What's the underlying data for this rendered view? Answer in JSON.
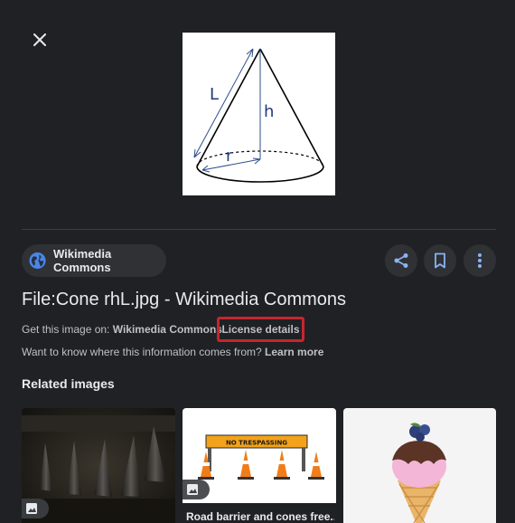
{
  "header": {
    "close_icon": "close-icon"
  },
  "preview": {
    "labels": {
      "slant": "L",
      "height": "h",
      "radius": "r"
    },
    "colors": {
      "line": "#000000",
      "arrow": "#2f4f8a",
      "label": "#1f3a7a"
    }
  },
  "source": {
    "icon": "globe-icon",
    "label": "Wikimedia Commons",
    "icon_color": "#4a86e8"
  },
  "actions": {
    "share_icon": "share-icon",
    "bookmark_icon": "bookmark-icon",
    "more_icon": "more-vert-icon",
    "accent": "#8ab4f8"
  },
  "title": "File:Cone rhL.jpg - Wikimedia Commons",
  "get_image": {
    "prefix": "Get this image on:",
    "source_link": "Wikimedia Commons",
    "license_link": "License details",
    "highlight_color": "#c5262e"
  },
  "info": {
    "prefix": "Want to know where this information comes from?",
    "link": "Learn more"
  },
  "related": {
    "title": "Related images",
    "items": [
      {
        "caption": "",
        "badge_icon": "image-icon"
      },
      {
        "caption": "Road barrier and cones free...",
        "badge_icon": "image-icon",
        "sign_text": "NO TRESPASSING"
      },
      {
        "caption": ""
      }
    ]
  }
}
